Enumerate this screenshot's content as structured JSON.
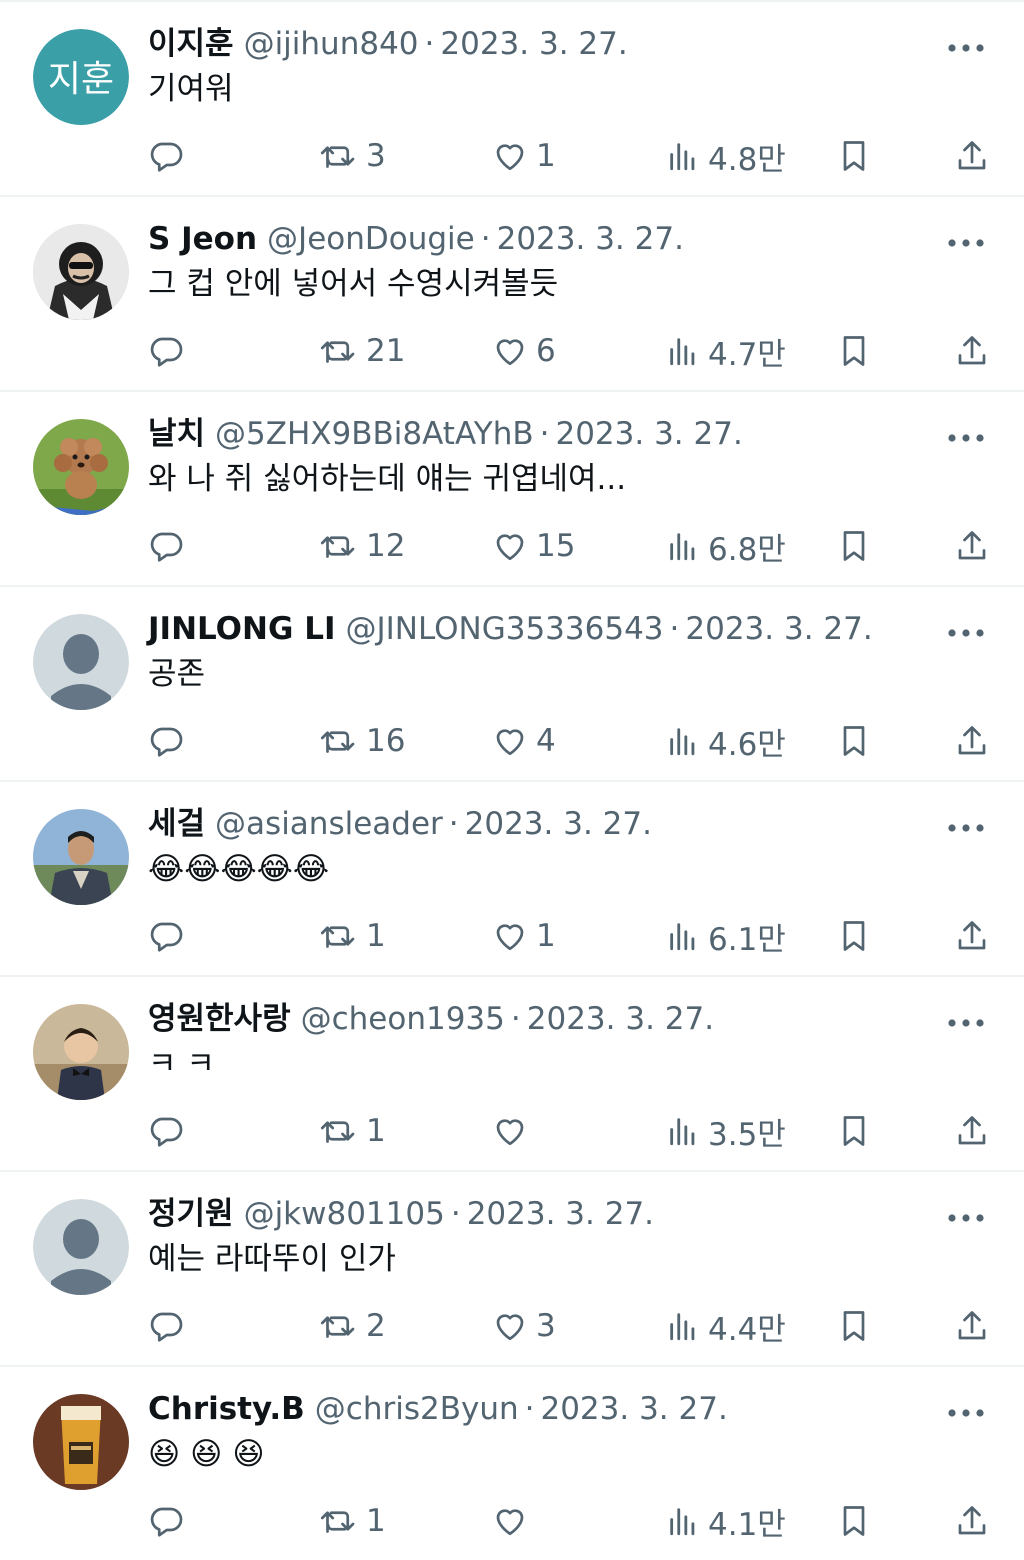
{
  "icons": {
    "reply": "reply-icon",
    "retweet": "retweet-icon",
    "like": "heart-icon",
    "views": "views-icon",
    "bookmark": "bookmark-icon",
    "share": "share-icon",
    "more": "more-icon"
  },
  "colors": {
    "text_primary": "#0f1419",
    "text_secondary": "#536471",
    "divider": "#eff3f4",
    "avatar_teal": "#3a9fa7",
    "avatar_default": "#cfd9de"
  },
  "tweets": [
    {
      "name": "이지훈",
      "handle": "@ijihun840",
      "separator": "·",
      "date": "2023. 3. 27.",
      "text": "기여워",
      "avatar_text": "지훈",
      "retweets": "3",
      "likes": "1",
      "views": "4.8만"
    },
    {
      "name": "S Jeon",
      "handle": "@JeonDougie",
      "separator": "·",
      "date": "2023. 3. 27.",
      "text": "그 컵 안에 넣어서 수영시켜볼듯",
      "retweets": "21",
      "likes": "6",
      "views": "4.7만"
    },
    {
      "name": "날치",
      "handle": "@5ZHX9BBi8AtAYhB",
      "separator": "·",
      "date": "2023. 3. 27.",
      "text": "와 나 쥐 싫어하는데 얘는 귀엽네여...",
      "retweets": "12",
      "likes": "15",
      "views": "6.8만"
    },
    {
      "name": "JINLONG LI",
      "handle": "@JINLONG35336543",
      "separator": "·",
      "date": "2023. 3. 27.",
      "text": "공존",
      "retweets": "16",
      "likes": "4",
      "views": "4.6만"
    },
    {
      "name": "세걸",
      "handle": "@asiansleader",
      "separator": "·",
      "date": "2023. 3. 27.",
      "text": "😂😂😂😂😂",
      "retweets": "1",
      "likes": "1",
      "views": "6.1만"
    },
    {
      "name": "영원한사랑",
      "handle": "@cheon1935",
      "separator": "·",
      "date": "2023. 3. 27.",
      "text": "ㅋ ㅋ",
      "retweets": "1",
      "likes": "",
      "views": "3.5만"
    },
    {
      "name": "정기원",
      "handle": "@jkw801105",
      "separator": "·",
      "date": "2023. 3. 27.",
      "text": "예는 라따뚜이 인가",
      "retweets": "2",
      "likes": "3",
      "views": "4.4만"
    },
    {
      "name": "Christy.B",
      "handle": "@chris2Byun",
      "separator": "·",
      "date": "2023. 3. 27.",
      "text": "😆 😆 😆",
      "retweets": "1",
      "likes": "",
      "views": "4.1만"
    }
  ]
}
